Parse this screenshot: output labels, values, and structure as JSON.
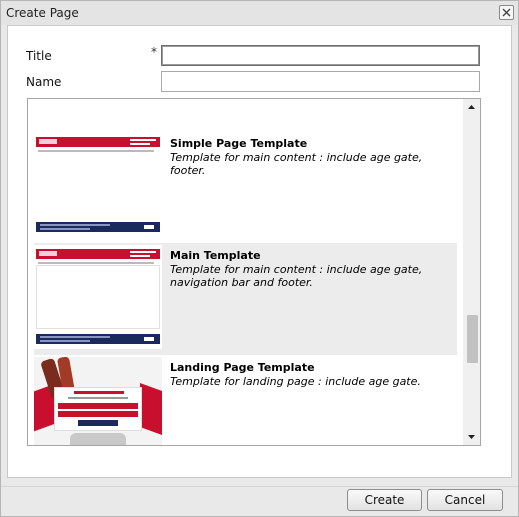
{
  "window": {
    "title": "Create Page",
    "close_icon": "close-icon"
  },
  "form": {
    "title_label": "Title",
    "title_required": "*",
    "title_value": "",
    "name_label": "Name",
    "name_value": ""
  },
  "templates": [
    {
      "name": "Simple Page Template",
      "description": "Template for main content : include age gate, footer."
    },
    {
      "name": "Main Template",
      "description": "Template for main content : include age gate, navigation bar and footer.",
      "selected": true
    },
    {
      "name": "Landing Page Template",
      "description": "Template for landing page : include age gate."
    }
  ],
  "buttons": {
    "create": "Create",
    "cancel": "Cancel"
  },
  "colors": {
    "brand_red": "#c8102e",
    "brand_navy": "#1b2a5c",
    "selected_bg": "#ececec"
  }
}
